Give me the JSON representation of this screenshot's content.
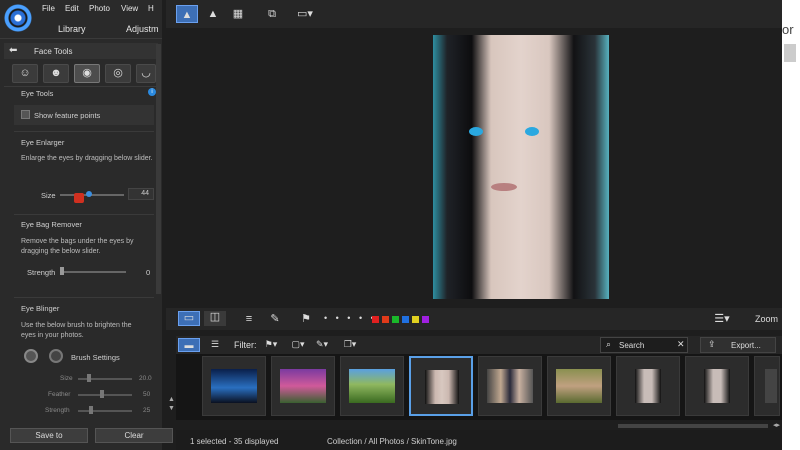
{
  "menu": {
    "file": "File",
    "edit": "Edit",
    "photo": "Photo",
    "view": "View",
    "help": "H"
  },
  "tabs": {
    "library": "Library",
    "adjust": "Adjustm"
  },
  "face_tools": {
    "title": "Face Tools"
  },
  "eye_tools": {
    "title": "Eye Tools",
    "show_feature_points": "Show feature points"
  },
  "eye_enlarger": {
    "title": "Eye Enlarger",
    "desc": "Enlarge the eyes by dragging below slider.",
    "size_label": "Size",
    "size_value": "44"
  },
  "eye_bag": {
    "title": "Eye Bag Remover",
    "desc1": "Remove the bags under the eyes by",
    "desc2": "dragging the below slider.",
    "strength_label": "Strength",
    "strength_value": "0"
  },
  "eye_blinger": {
    "title": "Eye Blinger",
    "desc1": "Use the below brush to brighten the",
    "desc2": "eyes in your photos.",
    "brush_settings": "Brush Settings",
    "size_label": "Size",
    "size_value": "20.0",
    "feather_label": "Feather",
    "feather_value": "50",
    "strength_label": "Strength",
    "strength_value": "25"
  },
  "buttons": {
    "save_to": "Save to",
    "clear": "Clear"
  },
  "toolbar": {
    "zoom": "Zoom",
    "filter": "Filter:",
    "search_placeholder": "Search",
    "export": "Export..."
  },
  "status": {
    "selected": "1 selected - 35 displayed",
    "path": "Collection / All Photos / SkinTone.jpg"
  },
  "right_edge": {
    "text": "or"
  },
  "colors": {
    "accent": "#3d6fb6",
    "selection": "#5aa0e8",
    "labels": [
      "#e02020",
      "#e03a1a",
      "#1ab82a",
      "#2070e0",
      "#e0d020",
      "#a020e0"
    ]
  }
}
